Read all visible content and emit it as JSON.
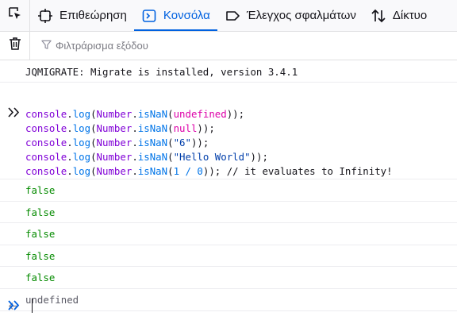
{
  "toolbar": {
    "picker_icon": "element-picker-icon",
    "tabs": [
      {
        "label": "Επιθεώρηση",
        "icon": "inspector-icon",
        "active": false
      },
      {
        "label": "Κονσόλα",
        "icon": "console-icon",
        "active": true
      },
      {
        "label": "Έλεγχος σφαλμάτων",
        "icon": "debugger-icon",
        "active": false
      },
      {
        "label": "Δίκτυο",
        "icon": "network-icon",
        "active": false
      }
    ],
    "accent_color": "#0061e0"
  },
  "filterbar": {
    "clear_icon": "trash-icon",
    "filter_icon": "funnel-icon",
    "filter_placeholder": "Φιλτράρισμα εξόδου"
  },
  "console": {
    "log_message": "JQMIGRATE: Migrate is installed, version 3.4.1",
    "results": [
      "false",
      "false",
      "false",
      "false",
      "false"
    ],
    "return_value": "undefined",
    "result_color": "#058b00"
  },
  "input_code": {
    "line1": {
      "a": "console",
      "b": ".",
      "c": "log",
      "d": "(",
      "e": "Number",
      "f": ".",
      "g": "isNaN",
      "h": "(",
      "i": "undefined",
      "j": "));"
    },
    "line2": {
      "a": "console",
      "b": ".",
      "c": "log",
      "d": "(",
      "e": "Number",
      "f": ".",
      "g": "isNaN",
      "h": "(",
      "i": "null",
      "j": "));"
    },
    "line3": {
      "a": "console",
      "b": ".",
      "c": "log",
      "d": "(",
      "e": "Number",
      "f": ".",
      "g": "isNaN",
      "h": "(",
      "i": "\"6\"",
      "j": "));"
    },
    "line4": {
      "a": "console",
      "b": ".",
      "c": "log",
      "d": "(",
      "e": "Number",
      "f": ".",
      "g": "isNaN",
      "h": "(",
      "i": "\"Hello World\"",
      "j": "));"
    },
    "line5": {
      "a": "console",
      "b": ".",
      "c": "log",
      "d": "(",
      "e": "Number",
      "f": ".",
      "g": "isNaN",
      "h": "(",
      "i": "1 / 0",
      "j": ")); // it evaluates to Infinity!"
    }
  }
}
